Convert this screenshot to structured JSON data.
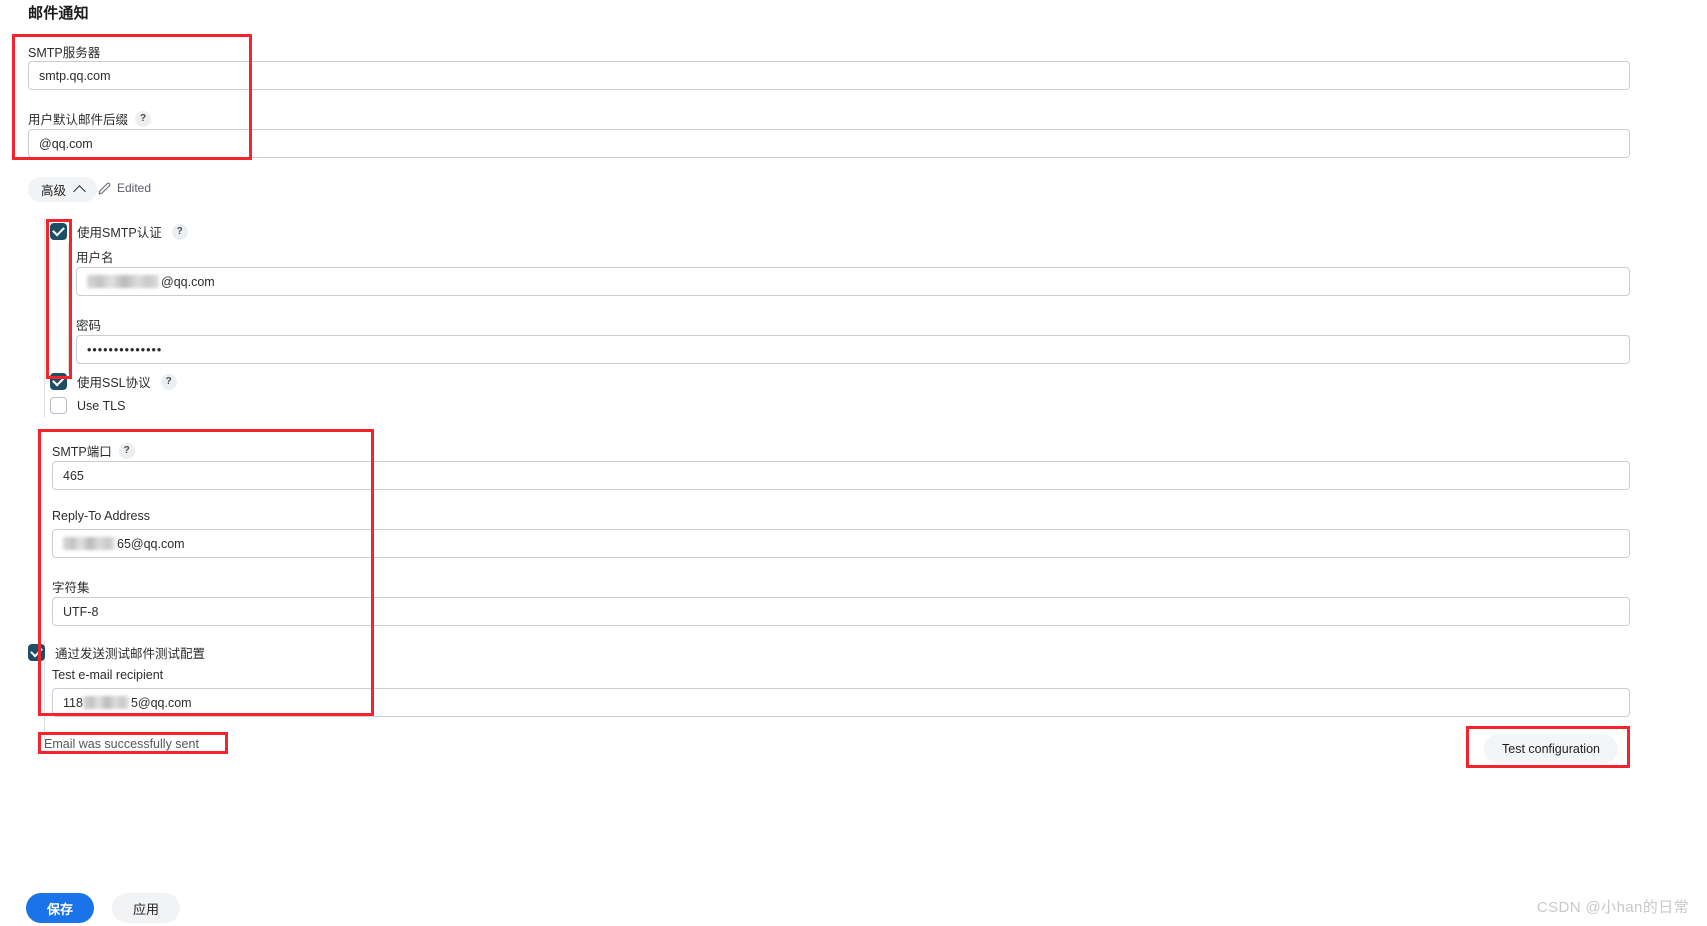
{
  "page": {
    "title": "邮件通知",
    "watermark": "CSDN @小han的日常"
  },
  "smtp_server": {
    "label": "SMTP服务器",
    "value": "smtp.qq.com"
  },
  "mail_suffix": {
    "label": "用户默认邮件后缀",
    "help": "?",
    "value": "@qq.com"
  },
  "advanced": {
    "label": "高级",
    "chevron": "chevron-up-icon",
    "edited_label": "Edited"
  },
  "smtp_auth": {
    "label": "使用SMTP认证",
    "help": "?",
    "checked": true
  },
  "username": {
    "label": "用户名",
    "value_suffix": "@qq.com",
    "redacted": true
  },
  "password": {
    "label": "密码",
    "value": "••••••••••••••"
  },
  "use_ssl": {
    "label": "使用SSL协议",
    "help": "?",
    "checked": true
  },
  "use_tls": {
    "label": "Use TLS",
    "checked": false
  },
  "smtp_port": {
    "label": "SMTP端口",
    "help": "?",
    "value": "465"
  },
  "reply_to": {
    "label": "Reply-To Address",
    "value_suffix": "65@qq.com",
    "redacted": true
  },
  "charset": {
    "label": "字符集",
    "value": "UTF-8"
  },
  "test_config_checkbox": {
    "label": "通过发送测试邮件测试配置",
    "checked": true
  },
  "test_recipient": {
    "label": "Test e-mail recipient",
    "value_prefix": "118",
    "value_suffix": "5@qq.com",
    "redacted": true
  },
  "status": {
    "message": "Email was successfully sent"
  },
  "actions": {
    "test_configuration": "Test configuration",
    "save": "保存",
    "apply": "应用"
  },
  "colors": {
    "annotation": "#f5232b",
    "primary": "#1a73e8",
    "checkbox_checked": "#1d4e63"
  }
}
